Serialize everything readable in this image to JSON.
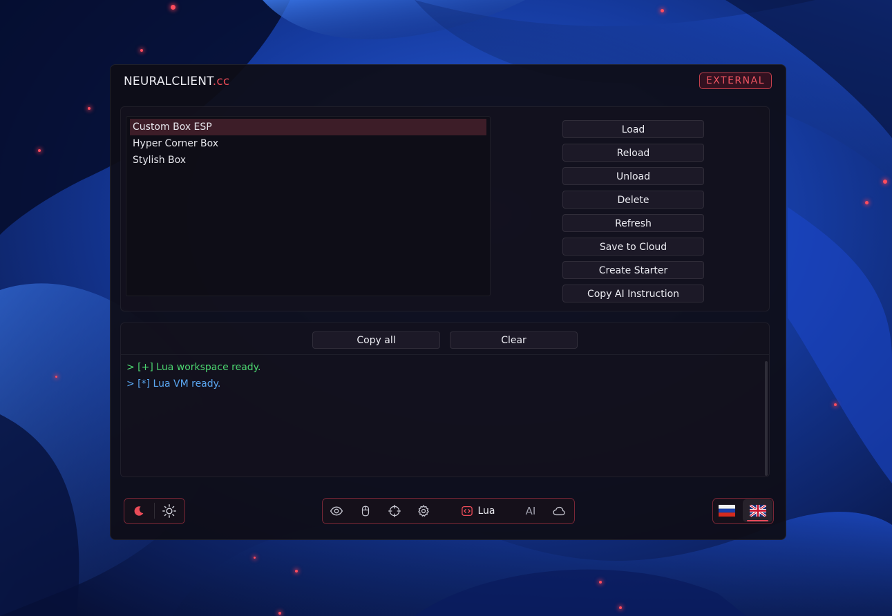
{
  "window": {
    "brand_main": "NEURALCLIENT",
    "brand_suffix": ".cc",
    "mode_badge": "EXTERNAL"
  },
  "scripts": {
    "items": [
      {
        "label": "Custom Box ESP",
        "selected": true
      },
      {
        "label": "Hyper Corner Box",
        "selected": false
      },
      {
        "label": "Stylish Box",
        "selected": false
      }
    ]
  },
  "actions": {
    "load": "Load",
    "reload": "Reload",
    "unload": "Unload",
    "delete": "Delete",
    "refresh": "Refresh",
    "save_to_cloud": "Save to Cloud",
    "create_starter": "Create Starter",
    "copy_ai_instruction": "Copy AI Instruction"
  },
  "console": {
    "copy_all": "Copy all",
    "clear": "Clear",
    "lines": [
      {
        "text": "> [+] Lua workspace ready.",
        "kind": "ok"
      },
      {
        "text": "> [*] Lua VM ready.",
        "kind": "info"
      }
    ]
  },
  "nav": {
    "items": [
      {
        "icon": "eye-icon"
      },
      {
        "icon": "mouse-icon"
      },
      {
        "icon": "crosshair-icon"
      },
      {
        "icon": "gear-icon"
      },
      {
        "icon": "code-icon",
        "label": "Lua",
        "active": true
      },
      {
        "label": "AI"
      },
      {
        "icon": "cloud-icon"
      }
    ]
  },
  "theme": {
    "icons": [
      "moon-icon",
      "sun-icon"
    ]
  },
  "language": {
    "options": [
      "russian-flag-icon",
      "uk-flag-icon"
    ],
    "selected": "uk-flag-icon"
  },
  "colors": {
    "accent": "#ea4b58",
    "log_ok": "#4cd670",
    "log_info": "#5aa6f0",
    "selected_row": "#3d1d28"
  }
}
